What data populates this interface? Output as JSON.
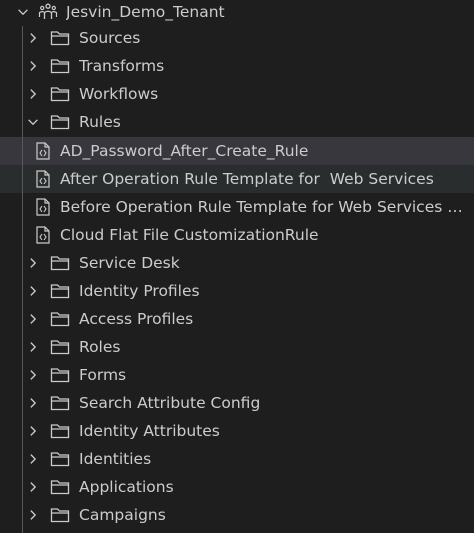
{
  "explorer": {
    "root": {
      "label": "Jesvin_Demo_Tenant",
      "icon": "tenant-icon",
      "expanded": true
    },
    "folders": [
      {
        "label": "Sources",
        "expanded": false
      },
      {
        "label": "Transforms",
        "expanded": false
      },
      {
        "label": "Workflows",
        "expanded": false
      },
      {
        "label": "Rules",
        "expanded": true
      },
      {
        "label": "Service Desk",
        "expanded": false
      },
      {
        "label": "Identity Profiles",
        "expanded": false
      },
      {
        "label": "Access Profiles",
        "expanded": false
      },
      {
        "label": "Roles",
        "expanded": false
      },
      {
        "label": "Forms",
        "expanded": false
      },
      {
        "label": "Search Attribute Config",
        "expanded": false
      },
      {
        "label": "Identity Attributes",
        "expanded": false
      },
      {
        "label": "Identities",
        "expanded": false
      },
      {
        "label": "Applications",
        "expanded": false
      },
      {
        "label": "Campaigns",
        "expanded": false
      }
    ],
    "rules": [
      {
        "label": "AD_Password_After_Create_Rule",
        "state": "selected"
      },
      {
        "label": "After Operation Rule Template for  Web Services",
        "state": "hover"
      },
      {
        "label": "Before Operation Rule Template for Web Services C...",
        "state": "normal"
      },
      {
        "label": "Cloud Flat File CustomizationRule",
        "state": "normal"
      }
    ]
  },
  "colors": {
    "background": "#1e1e1e",
    "text": "#cccccc",
    "selected_row": "#37373d",
    "hover_row": "#2a2d2e",
    "indent_guide": "#585858"
  }
}
